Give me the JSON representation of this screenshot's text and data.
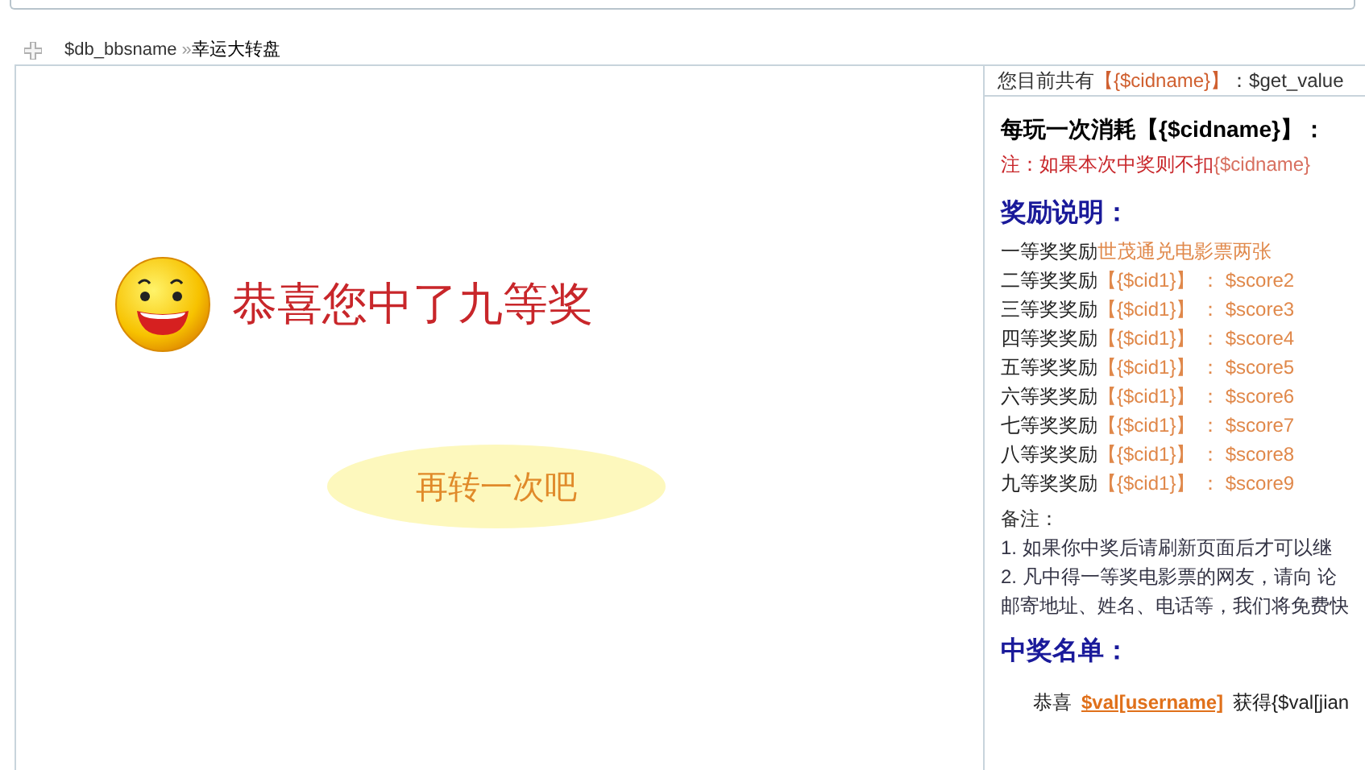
{
  "breadcrumb": {
    "site": "$db_bbsname",
    "separator": "»",
    "page": "幸运大转盘"
  },
  "result": {
    "message": "恭喜您中了九等奖",
    "retry_button": "再转一次吧"
  },
  "sidebar": {
    "balance_label": "您目前共有",
    "balance_unit": "【{$cidname}】",
    "balance_value": "：$get_value",
    "cost_title": "每玩一次消耗【{$cidname}】：",
    "cost_note": "注：如果本次中奖则不扣",
    "cost_note_unit": "{$cidname}",
    "rewards_title": "奖励说明：",
    "rewards": [
      {
        "label": "一等奖奖励",
        "reward": "世茂通兑电影票两张"
      },
      {
        "label": "二等奖奖励",
        "reward": "【{$cid1}】 ： $score2"
      },
      {
        "label": "三等奖奖励",
        "reward": "【{$cid1}】 ： $score3"
      },
      {
        "label": "四等奖奖励",
        "reward": "【{$cid1}】 ： $score4"
      },
      {
        "label": "五等奖奖励",
        "reward": "【{$cid1}】 ： $score5"
      },
      {
        "label": "六等奖奖励",
        "reward": "【{$cid1}】 ： $score6"
      },
      {
        "label": "七等奖奖励",
        "reward": "【{$cid1}】 ： $score7"
      },
      {
        "label": "八等奖奖励",
        "reward": "【{$cid1}】 ： $score8"
      },
      {
        "label": "九等奖奖励",
        "reward": "【{$cid1}】 ： $score9"
      }
    ],
    "notes_title": "备注：",
    "notes": [
      "1. 如果你中奖后请刷新页面后才可以继",
      "2. 凡中得一等奖电影票的网友，请向 论",
      "邮寄地址、姓名、电话等，我们将免费快"
    ],
    "winners_title": "中奖名单：",
    "winner": {
      "prefix": "恭喜",
      "username": "$val[username]",
      "suffix": "获得{$val[jian"
    }
  }
}
